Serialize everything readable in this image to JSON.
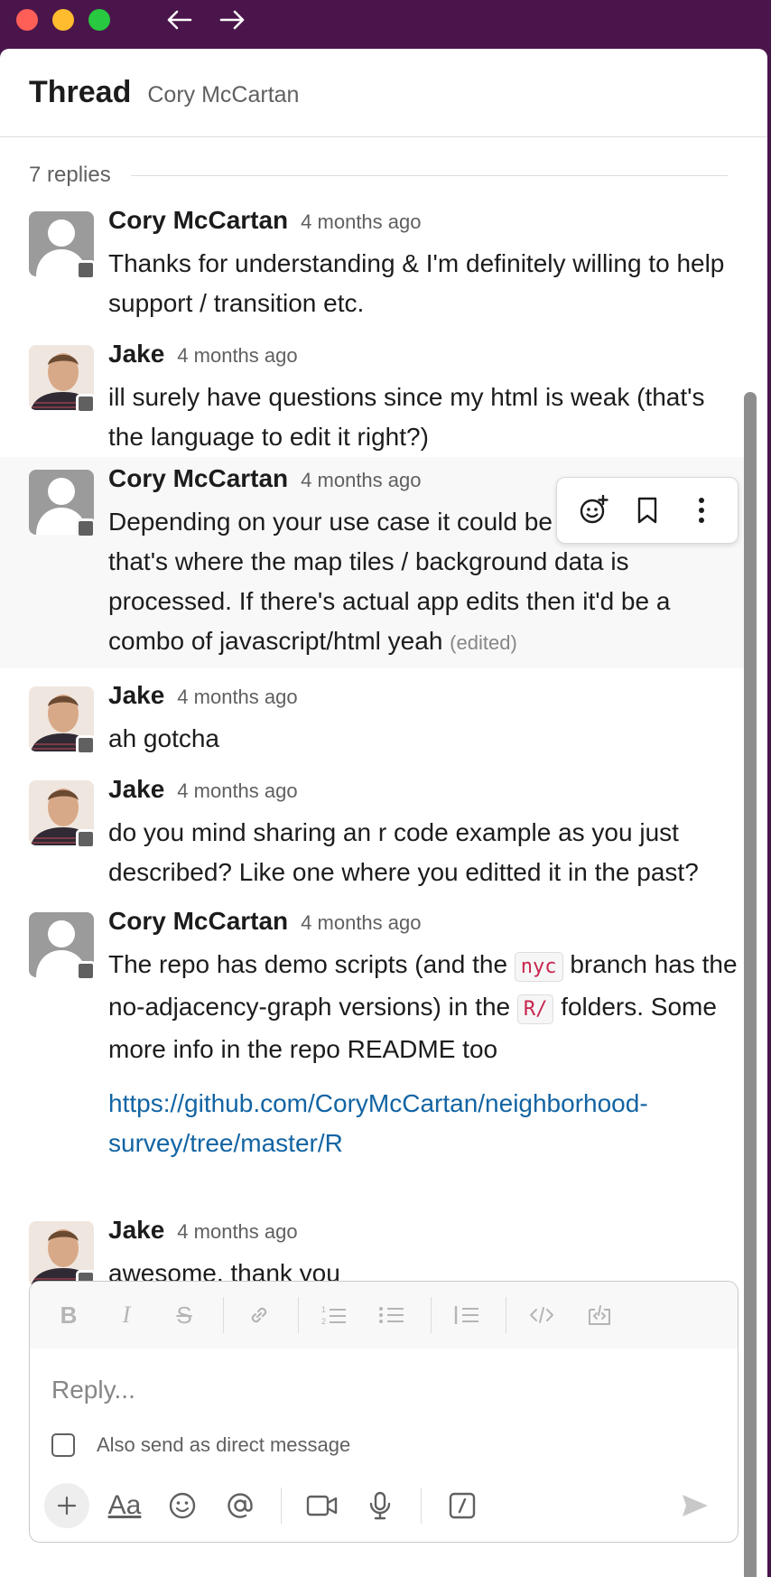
{
  "window": {
    "back_label": "←",
    "forward_label": "→"
  },
  "header": {
    "title": "Thread",
    "subtitle": "Cory McCartan"
  },
  "replies_label": "7 replies",
  "messages": [
    {
      "author": "Cory McCartan",
      "time": "4 months ago",
      "text": "Thanks for understanding & I'm definitely willing to help support / transition etc."
    },
    {
      "author": "Jake",
      "time": "4 months ago",
      "text": "ill surely have questions since my html is weak (that's the language to edit it right?)"
    },
    {
      "author": "Cory McCartan",
      "time": "4 months ago",
      "text": "Depending on your use case it could be all in R since that's where the map tiles / background data is processed.  If there's actual app edits then it'd be a combo of javascript/html  yeah",
      "edited": "(edited)"
    },
    {
      "author": "Jake",
      "time": "4 months ago",
      "text": "ah gotcha"
    },
    {
      "author": "Jake",
      "time": "4 months ago",
      "text": "do you mind sharing an r code example as you just described? Like one where you editted it in the past?"
    },
    {
      "author": "Cory McCartan",
      "time": "4 months ago",
      "text_a": "The repo has demo scripts (and the",
      "code_1": "nyc",
      "text_b": "branch has the no-adjacency-graph versions) in the",
      "code_2": "R/",
      "text_c": "folders. Some more info in the repo README too",
      "link": "https://github.com/CoryMcCartan/neighborhood-survey/tree/master/R"
    },
    {
      "author": "Jake",
      "time": "4 months ago",
      "text": "awesome, thank you"
    }
  ],
  "hover_actions": [
    "add-reaction-icon",
    "bookmark-icon",
    "more-actions-icon"
  ],
  "composer": {
    "placeholder": "Reply...",
    "also_send_label": "Also send as direct message",
    "format_label": "Aa"
  },
  "colors": {
    "window_chrome": "#4a154b",
    "link": "#1264a3",
    "code_text": "#c7254e"
  }
}
